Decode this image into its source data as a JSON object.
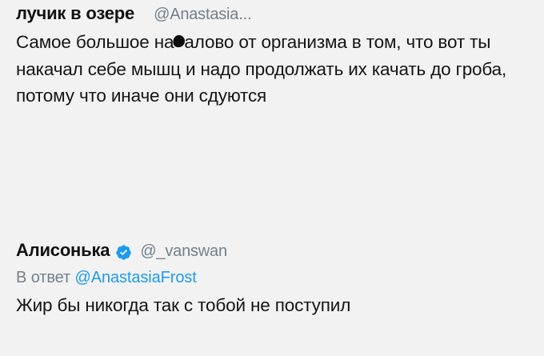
{
  "tweet_original": {
    "display_name": "лучик в озере",
    "handle": "@Anastasia...",
    "text_before_censor": "Самое большое на",
    "text_after_censor": "алово от организма в том, что вот ты накачал себе мышц и надо продолжать их качать до гроба, потому что иначе они сдуются"
  },
  "tweet_reply": {
    "display_name": "Алисонька",
    "verified_icon": "verified-badge-icon",
    "handle": "@_vanswan",
    "reply_prefix": "В ответ",
    "reply_to_handle": "@AnastasiaFrost",
    "text": "Жир бы никогда так с тобой не поступил"
  },
  "colors": {
    "background": "#f2f2f2",
    "text": "#121212",
    "handle": "#74808a",
    "link": "#1d9bf0",
    "verified": "#1d9bf0"
  }
}
